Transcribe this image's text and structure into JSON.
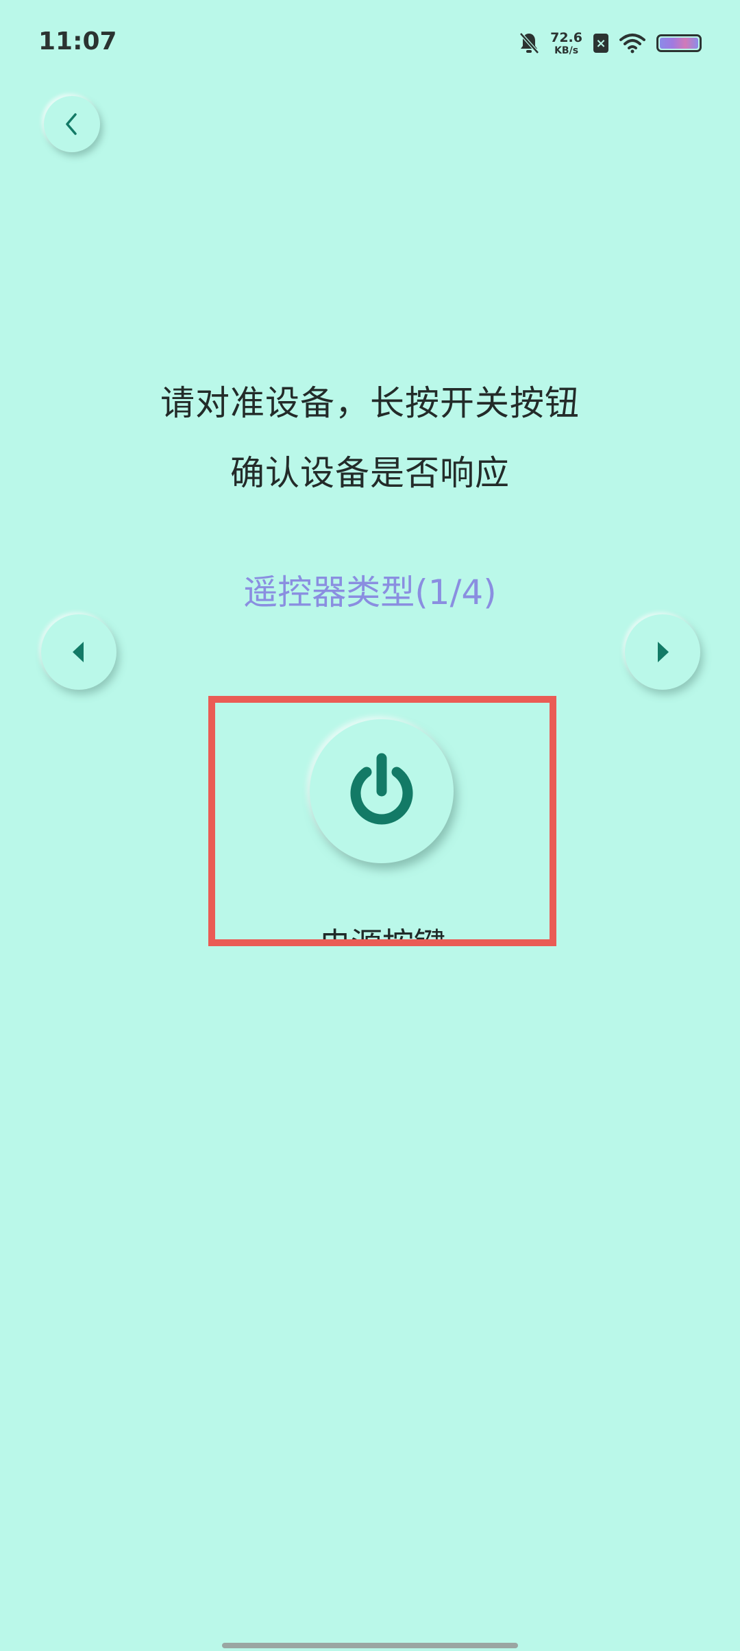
{
  "status_bar": {
    "time": "11:07",
    "net_speed_value": "72.6",
    "net_speed_unit": "KB/s",
    "sim_status": "×",
    "icons": [
      "bell-muted-icon",
      "sim-x-icon",
      "wifi-icon",
      "battery-icon"
    ]
  },
  "instructions": {
    "line1": "请对准设备，长按开关按钮",
    "line2": "确认设备是否响应"
  },
  "remote_type": {
    "label": "遥控器类型(1/4)"
  },
  "key": {
    "label": "电源按键",
    "icon": "power-icon"
  },
  "colors": {
    "background": "#BAF8E9",
    "accent": "#137A66",
    "type_label": "#8A8EE0",
    "highlight": "#EA5C55"
  }
}
